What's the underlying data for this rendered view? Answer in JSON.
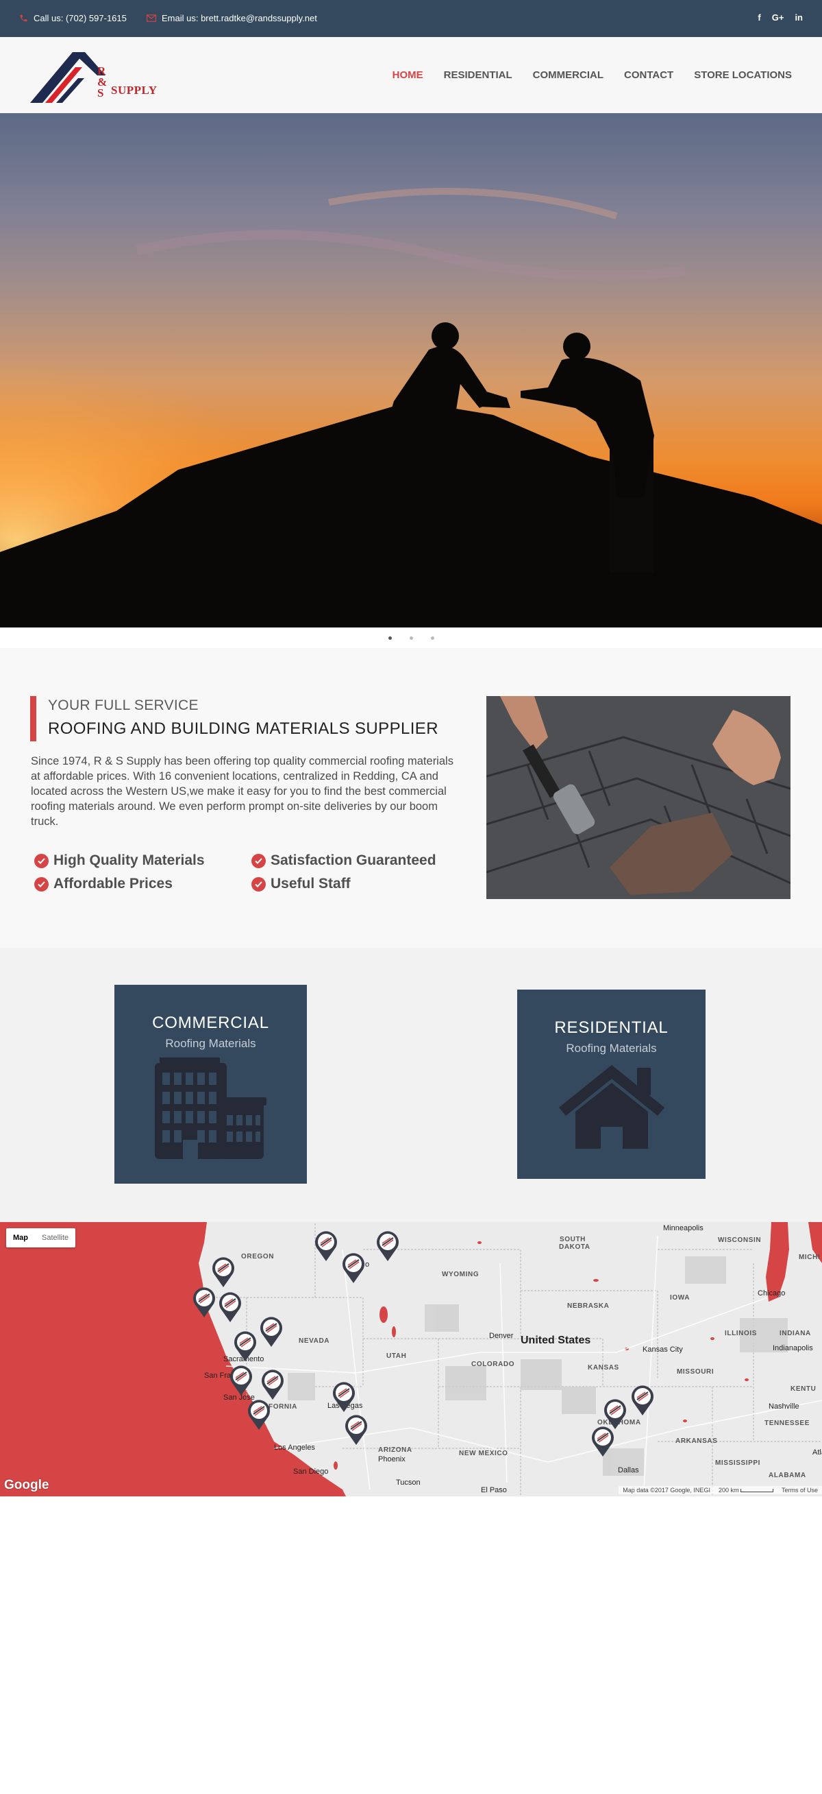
{
  "topbar": {
    "phone_label": "Call us: (702) 597-1615",
    "email_label": "Email us: brett.radtke@randssupply.net",
    "social": {
      "facebook": "f",
      "googleplus": "G+",
      "linkedin": "in"
    },
    "background": "#34495e",
    "icon_color": "#d64545"
  },
  "logo": {
    "line1": "R",
    "line2": "&",
    "line3": "S",
    "supply": "SUPPLY"
  },
  "nav": {
    "items": [
      {
        "label": "HOME",
        "active": true
      },
      {
        "label": "RESIDENTIAL",
        "active": false
      },
      {
        "label": "COMMERCIAL",
        "active": false
      },
      {
        "label": "CONTACT",
        "active": false
      },
      {
        "label": "STORE LOCATIONS",
        "active": false
      }
    ],
    "accent": "#d64545"
  },
  "slider": {
    "slide_count": 3,
    "active_index": 0
  },
  "about": {
    "kicker": "YOUR FULL SERVICE",
    "title": "ROOFING AND BUILDING MATERIALS SUPPLIER",
    "description": "Since 1974, R & S Supply has been offering top quality commercial roofing materials at affordable prices. With 16 convenient locations, centralized in Redding, CA and located across the Western US,we make it easy for you to find the best commercial roofing materials around. We even perform prompt on-site deliveries by our boom truck.",
    "features": [
      "High Quality Materials",
      "Satisfaction Guaranteed",
      "Affordable Prices",
      "Useful Staff"
    ]
  },
  "services": {
    "commercial": {
      "title": "COMMERCIAL",
      "subtitle": "Roofing Materials",
      "icon": "building-icon"
    },
    "residential": {
      "title": "RESIDENTIAL",
      "subtitle": "Roofing Materials",
      "icon": "house-icon"
    },
    "card_color": "#34495e"
  },
  "map": {
    "toggle": {
      "map": "Map",
      "satellite": "Satellite"
    },
    "country_label": "United States",
    "states": [
      "OREGON",
      "SOUTH DAKOTA",
      "WISCONSIN",
      "MICHI",
      "WYOMING",
      "IOWA",
      "NEBRASKA",
      "NEVADA",
      "ILLINOIS",
      "INDIANA",
      "UTAH",
      "COLORADO",
      "KANSAS",
      "MISSOURI",
      "KENTU",
      "FORNIA",
      "OKLAHOMA",
      "TENNESSEE",
      "ARIZONA",
      "NEW MEXICO",
      "ARKANSAS",
      "MISSISSIPPI",
      "ALABAMA"
    ],
    "cities": [
      "Minneapolis",
      "Chicago",
      "Denver",
      "Kansas City",
      "Indianapolis",
      "Sacramento",
      "San Fra",
      "San Jose",
      "Las Vegas",
      "Nashville",
      "Los Angeles",
      "Phoenix",
      "San Diego",
      "Tucson",
      "El Paso",
      "Dallas",
      "Atla",
      "o"
    ],
    "google": "Google",
    "attribution": "Map data ©2017 Google, INEGI",
    "scale": "200 km",
    "terms": "Terms of Use",
    "store_pin_count": 16,
    "highlight_color": "#d64545"
  }
}
